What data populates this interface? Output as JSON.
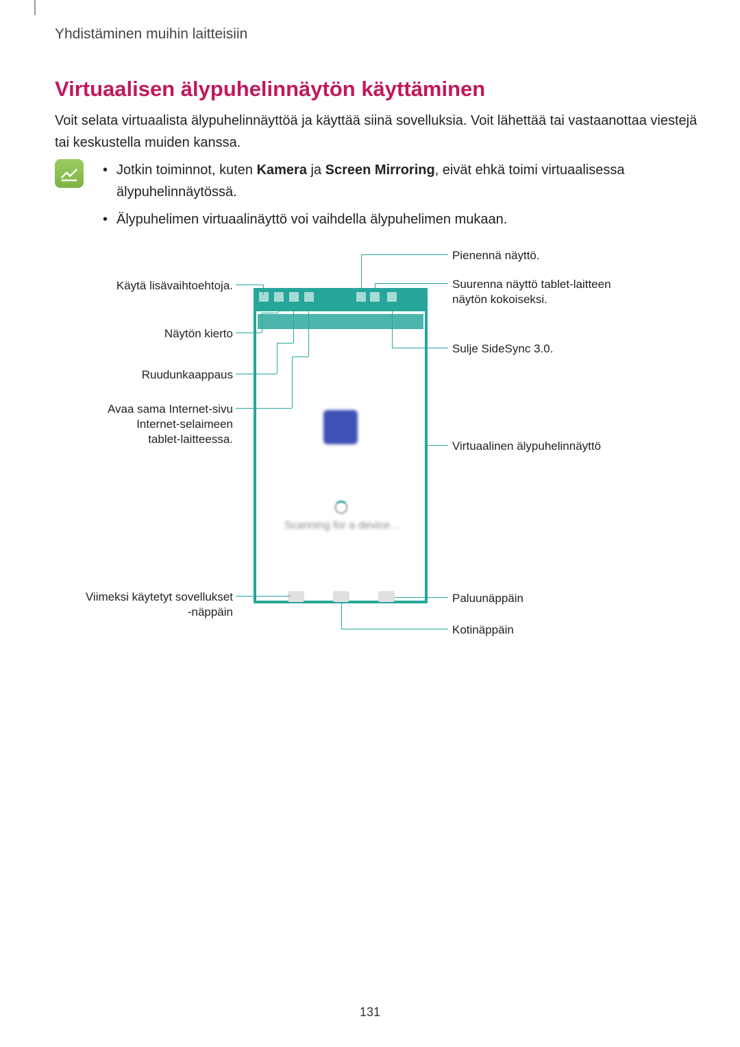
{
  "header": "Yhdistäminen muihin laitteisiin",
  "section_title": "Virtuaalisen älypuhelinnäytön käyttäminen",
  "body_para": "Voit selata virtuaalista älypuhelinnäyttöä ja käyttää siinä sovelluksia. Voit lähettää tai vastaanottaa viestejä tai keskustella muiden kanssa.",
  "note": {
    "item1_pre": "Jotkin toiminnot, kuten ",
    "item1_b1": "Kamera",
    "item1_mid": " ja ",
    "item1_b2": "Screen Mirroring",
    "item1_post": ", eivät ehkä toimi virtuaalisessa älypuhelinnäytössä.",
    "item2": "Älypuhelimen virtuaalinäyttö voi vaihdella älypuhelimen mukaan."
  },
  "labels": {
    "left": {
      "more": "Käytä lisävaihtoehtoja.",
      "rotate": "Näytön kierto",
      "capture": "Ruudunkaappaus",
      "internet_l1": "Avaa sama Internet-sivu",
      "internet_l2": "Internet-selaimeen",
      "internet_l3": "tablet-laitteessa.",
      "recent_l1": "Viimeksi käytetyt sovellukset",
      "recent_l2": "-näppäin"
    },
    "right": {
      "minimize": "Pienennä näyttö.",
      "maximize_l1": "Suurenna näyttö tablet-laitteen",
      "maximize_l2": "näytön kokoiseksi.",
      "close": "Sulje SideSync 3.0.",
      "virtual": "Virtuaalinen älypuhelinnäyttö",
      "back": "Paluunäppäin",
      "home": "Kotinäppäin"
    }
  },
  "phone_text": "Scanning for a device…",
  "page_number": "131"
}
